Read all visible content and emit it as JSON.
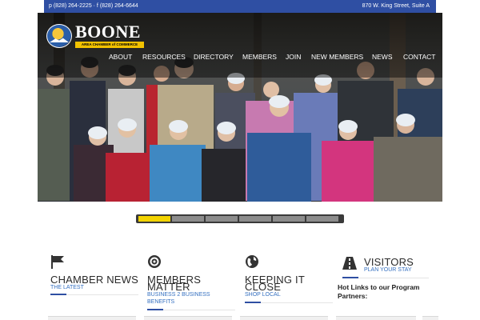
{
  "topbar": {
    "phone": "p (828) 264-2225 · f (828) 264-6644",
    "address": "870 W. King Street, Suite A"
  },
  "logo": {
    "name": "BOONE",
    "subtitle": "AREA CHAMBER of COMMERCE"
  },
  "nav": {
    "items": [
      "ABOUT",
      "RESOURCES",
      "DIRECTORY",
      "MEMBERS",
      "JOIN",
      "NEW MEMBERS",
      "NEWS",
      "CONTACT"
    ]
  },
  "slider": {
    "count": 6,
    "active_index": 0
  },
  "sections": [
    {
      "title": "CHAMBER NEWS",
      "subtitle": "THE LATEST",
      "icon": "flag-icon"
    },
    {
      "title_line1": "MEMBERS",
      "title_line2": "MATTER",
      "subtitle_line1": "BUSINESS 2 BUSINESS",
      "subtitle_line2": "BENEFITS",
      "icon": "target-icon"
    },
    {
      "title_line1": "KEEPING IT",
      "title_line2": "CLOSE",
      "subtitle": "SHOP LOCAL",
      "icon": "globe-icon"
    },
    {
      "title": "VISITORS",
      "subtitle": "PLAN YOUR STAY",
      "icon": "road-icon"
    }
  ],
  "hotlinks": "Hot Links to our Program Partners:",
  "colors": {
    "topbar": "#2f4fa3",
    "accent_link": "#3570c0",
    "slider_active": "#f2d300"
  }
}
